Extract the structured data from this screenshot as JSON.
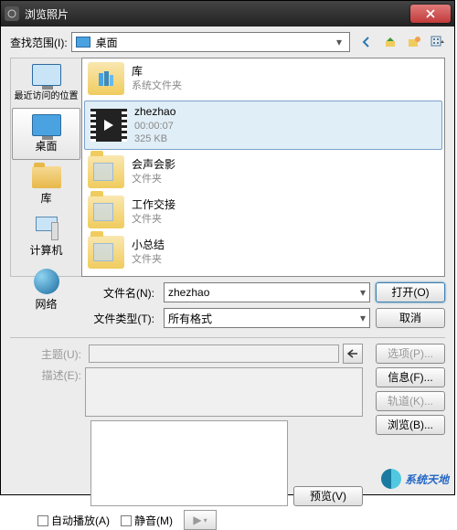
{
  "titlebar": {
    "title": "浏览照片",
    "close": "X"
  },
  "lookin": {
    "label": "查找范围(I):",
    "value": "桌面"
  },
  "sidebar": {
    "recent": "最近访问的位置",
    "desktop": "桌面",
    "libraries": "库",
    "computer": "计算机",
    "network": "网络"
  },
  "files": {
    "lib": {
      "name": "库",
      "sub": "系统文件夹"
    },
    "zhezhao": {
      "name": "zhezhao",
      "duration": "00:00:07",
      "size": "325 KB"
    },
    "hshy": {
      "name": "会声会影",
      "sub": "文件夹"
    },
    "gzjh": {
      "name": "工作交接",
      "sub": "文件夹"
    },
    "xzj": {
      "name": "小总结",
      "sub": "文件夹"
    }
  },
  "fields": {
    "filename_label": "文件名(N):",
    "filename_value": "zhezhao",
    "filetype_label": "文件类型(T):",
    "filetype_value": "所有格式",
    "subject_label": "主题(U):",
    "desc_label": "描述(E):"
  },
  "buttons": {
    "open": "打开(O)",
    "cancel": "取消",
    "options": "选项(P)...",
    "info": "信息(F)...",
    "track": "轨道(K)...",
    "browse": "浏览(B)...",
    "preview": "预览(V)"
  },
  "controls": {
    "autoplay": "自动播放(A)",
    "mute": "静音(M)",
    "play_glyph": "▶"
  },
  "branding": {
    "text": "系统天地"
  }
}
